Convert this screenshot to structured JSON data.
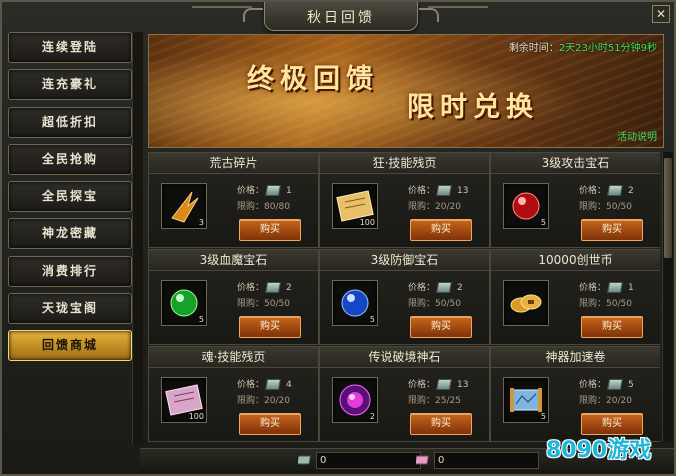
{
  "window": {
    "title": "秋日回馈",
    "close_label": "✕"
  },
  "sidebar": {
    "items": [
      {
        "label": "连续登陆",
        "active": false
      },
      {
        "label": "连充豪礼",
        "active": false
      },
      {
        "label": "超低折扣",
        "active": false
      },
      {
        "label": "全民抢购",
        "active": false
      },
      {
        "label": "全民探宝",
        "active": false
      },
      {
        "label": "神龙密藏",
        "active": false
      },
      {
        "label": "消费排行",
        "active": false
      },
      {
        "label": "天珑宝阁",
        "active": false
      },
      {
        "label": "回馈商城",
        "active": true
      }
    ]
  },
  "banner": {
    "remain_label": "剩余时间：",
    "remain_time": "2天23小时51分钟9秒",
    "headline_1": "终极回馈",
    "headline_2": "限时兑换",
    "rules_link": "活动说明"
  },
  "shop": {
    "price_label": "价格：",
    "limit_label": "限购：",
    "buy_label": "购买",
    "items": [
      {
        "name": "荒古碎片",
        "count": "3",
        "price": "1",
        "limit": "80/80",
        "icon": "wing-shard-icon"
      },
      {
        "name": "狂·技能残页",
        "count": "100",
        "price": "13",
        "limit": "20/20",
        "icon": "scroll-page-icon"
      },
      {
        "name": "3级攻击宝石",
        "count": "5",
        "price": "2",
        "limit": "50/50",
        "icon": "red-gem-icon"
      },
      {
        "name": "3级血魔宝石",
        "count": "5",
        "price": "2",
        "limit": "50/50",
        "icon": "green-gem-icon"
      },
      {
        "name": "3级防御宝石",
        "count": "5",
        "price": "2",
        "limit": "50/50",
        "icon": "blue-gem-icon"
      },
      {
        "name": "10000创世币",
        "count": "",
        "price": "1",
        "limit": "50/50",
        "icon": "coin-icon"
      },
      {
        "name": "魂·技能残页",
        "count": "100",
        "price": "4",
        "limit": "20/20",
        "icon": "purple-scroll-icon"
      },
      {
        "name": "传说破境神石",
        "count": "2",
        "price": "13",
        "limit": "25/25",
        "icon": "magic-stone-icon"
      },
      {
        "name": "神器加速卷",
        "count": "5",
        "price": "5",
        "limit": "20/20",
        "icon": "map-scroll-icon"
      }
    ]
  },
  "footer": {
    "currency_1_value": "0",
    "currency_2_value": "0"
  },
  "watermark": "8090游戏",
  "colors": {
    "accent_gold": "#e7b43a",
    "buy_orange": "#c8651c",
    "timer_green": "#3ee05a"
  }
}
